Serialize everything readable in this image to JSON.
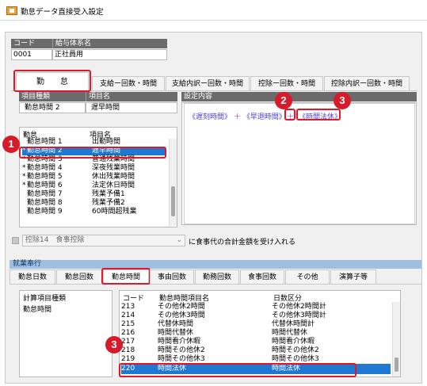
{
  "window": {
    "title": "勤怠データ直接受入設定"
  },
  "top_grid": {
    "headers": [
      "コード",
      "給与体系名"
    ],
    "row": [
      "0001",
      "正社員用"
    ]
  },
  "main_tabs": [
    "勤　　怠",
    "支給ー回数・時間",
    "支給内訳ー回数・時間",
    "控除ー回数・時間",
    "控除内訳ー回数・時間"
  ],
  "item": {
    "headers": [
      "項目種類",
      "項目名"
    ],
    "row": [
      "勤怠時間 2",
      "遅早時間"
    ]
  },
  "list_box": {
    "headers": [
      "勤怠",
      "項目名"
    ],
    "rows": [
      {
        "mark": "",
        "kind": "勤怠時間 1",
        "name": "出勤時間"
      },
      {
        "mark": "*",
        "kind": "勤怠時間 2",
        "name": "遅早時間",
        "selected": true
      },
      {
        "mark": "*",
        "kind": "勤怠時間 3",
        "name": "普通残業時間"
      },
      {
        "mark": "*",
        "kind": "勤怠時間 4",
        "name": "深夜残業時間"
      },
      {
        "mark": "*",
        "kind": "勤怠時間 5",
        "name": "休出残業時間"
      },
      {
        "mark": "*",
        "kind": "勤怠時間 6",
        "name": "法定休日時間"
      },
      {
        "mark": "",
        "kind": "勤怠時間 7",
        "name": "残業予備1"
      },
      {
        "mark": "",
        "kind": "勤怠時間 8",
        "name": "残業予備2"
      },
      {
        "mark": "",
        "kind": "勤怠時間 9",
        "name": "60時間超残業"
      }
    ]
  },
  "settings": {
    "header": "設定内容",
    "tokens": [
      "《遅刻時間》",
      "＋",
      "《早退時間》",
      "＋",
      "《時間法休》"
    ]
  },
  "badges": {
    "one": "1",
    "two": "2",
    "three": "3"
  },
  "deduction": {
    "select_value": "控除14　食事控除",
    "label": "に食事代の合計金額を受け入れる"
  },
  "bottom": {
    "section_label": "就業奉行",
    "tabs": [
      "勤怠日数",
      "勤怠回数",
      "勤怠時間",
      "事由回数",
      "勤務回数",
      "食事回数",
      "その他",
      "演算子等"
    ],
    "left_header": "計算項目種類",
    "left_item": "勤怠時間",
    "right_headers": [
      "コード",
      "勤怠時間項目名",
      "日数区分"
    ],
    "rows": [
      {
        "code": "213",
        "name": "その他休2時間",
        "kubun": "その他休2時間計"
      },
      {
        "code": "214",
        "name": "その他休3時間",
        "kubun": "その他休3時間計"
      },
      {
        "code": "215",
        "name": "代替休時間",
        "kubun": "代替休時間計"
      },
      {
        "code": "216",
        "name": "時間代替休",
        "kubun": "時間代替休"
      },
      {
        "code": "217",
        "name": "時間看介休暇",
        "kubun": "時間看介休暇"
      },
      {
        "code": "218",
        "name": "時間その他休2",
        "kubun": "時間その他休2"
      },
      {
        "code": "219",
        "name": "時間その他休3",
        "kubun": "時間その他休3"
      },
      {
        "code": "220",
        "name": "時間法休",
        "kubun": "時間法休",
        "selected": true
      }
    ]
  },
  "colors": {
    "accent_red": "#e0182b",
    "selection": "#1f78d1",
    "header_gray": "#6b6b6b"
  }
}
